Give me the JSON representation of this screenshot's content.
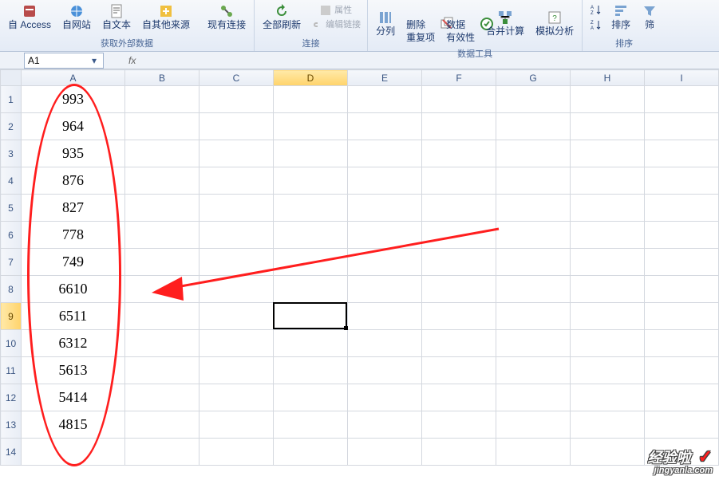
{
  "ribbon": {
    "external_data": {
      "access": "自 Access",
      "web": "自网站",
      "text": "自文本",
      "other": "自其他来源",
      "existing": "现有连接",
      "label": "获取外部数据"
    },
    "connections": {
      "refresh_all": "全部刷新",
      "props": "属性",
      "edit_links": "编辑链接",
      "label": "连接"
    },
    "data_tools": {
      "text_to_col": "分列",
      "remove_dup": "删除\n重复项",
      "validation": "数据\n有效性",
      "consolidate": "合并计算",
      "whatif": "模拟分析",
      "label": "数据工具"
    },
    "sort": {
      "sort": "排序",
      "filter_partial": "筛",
      "label": "排序"
    }
  },
  "formula_bar": {
    "name_box": "A1",
    "fx": "fx"
  },
  "columns": [
    "A",
    "B",
    "C",
    "D",
    "E",
    "F",
    "G",
    "H",
    "I"
  ],
  "rows": [
    1,
    2,
    3,
    4,
    5,
    6,
    7,
    8,
    9,
    10,
    11,
    12,
    13,
    14
  ],
  "cells": {
    "A1": "993",
    "A2": "964",
    "A3": "935",
    "A4": "876",
    "A5": "827",
    "A6": "778",
    "A7": "749",
    "A8": "6610",
    "A9": "6511",
    "A10": "6312",
    "A11": "5613",
    "A12": "5414",
    "A13": "4815"
  },
  "active_cell": "D9",
  "active_col": "D",
  "active_row": 9,
  "watermark": {
    "brand": "经验啦",
    "url": "jingyanla.com"
  }
}
